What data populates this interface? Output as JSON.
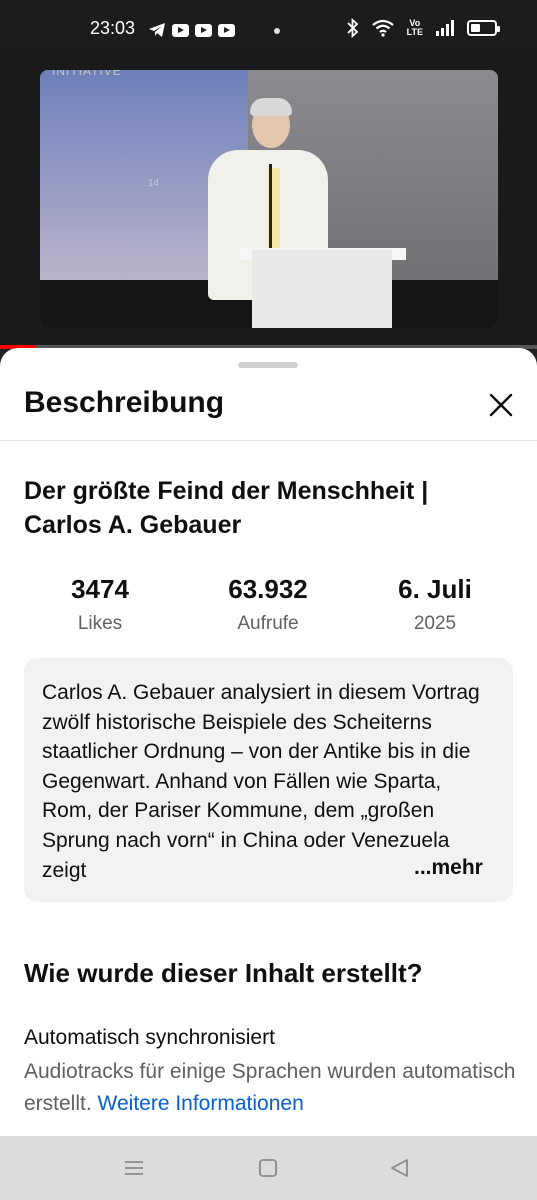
{
  "status_bar": {
    "time": "23:03",
    "volte_top": "Vo",
    "volte_bottom": "LTE",
    "icons": [
      "telegram-icon",
      "youtube-icon",
      "youtube-icon",
      "youtube-icon",
      "bluetooth-icon",
      "wifi-icon",
      "signal-icon",
      "battery-icon"
    ]
  },
  "video": {
    "slide_number": "14",
    "watermark": "INITIATIVE",
    "progress_fraction": 0.067,
    "progress_color": "#ff0000"
  },
  "sheet": {
    "title": "Beschreibung",
    "video_title": "Der größte Feind der Menschheit | Carlos A. Gebauer",
    "stats": [
      {
        "value": "3474",
        "label": "Likes"
      },
      {
        "value": "63.932",
        "label": "Aufrufe"
      },
      {
        "value": "6. Juli",
        "label": "2025"
      }
    ],
    "description": "Carlos A. Gebauer analysiert in diesem Vortrag zwölf historische Beispiele des Scheiterns staatlicher Ordnung – von der Antike bis in die Gegenwart. Anhand von Fällen wie Sparta, Rom, der Pariser Kommune, dem „großen Sprung nach vorn“ in China oder Venezuela zeigt",
    "more_label": "...mehr",
    "how_title": "Wie wurde dieser Inhalt erstellt?",
    "auto_title": "Automatisch synchronisiert",
    "auto_text": "Audiotracks für einige Sprachen wurden automatisch erstellt.",
    "auto_link": "Weitere Informationen"
  },
  "colors": {
    "link": "#065fd4",
    "secondary_text": "#606060",
    "box_bg": "#f2f2f2"
  }
}
